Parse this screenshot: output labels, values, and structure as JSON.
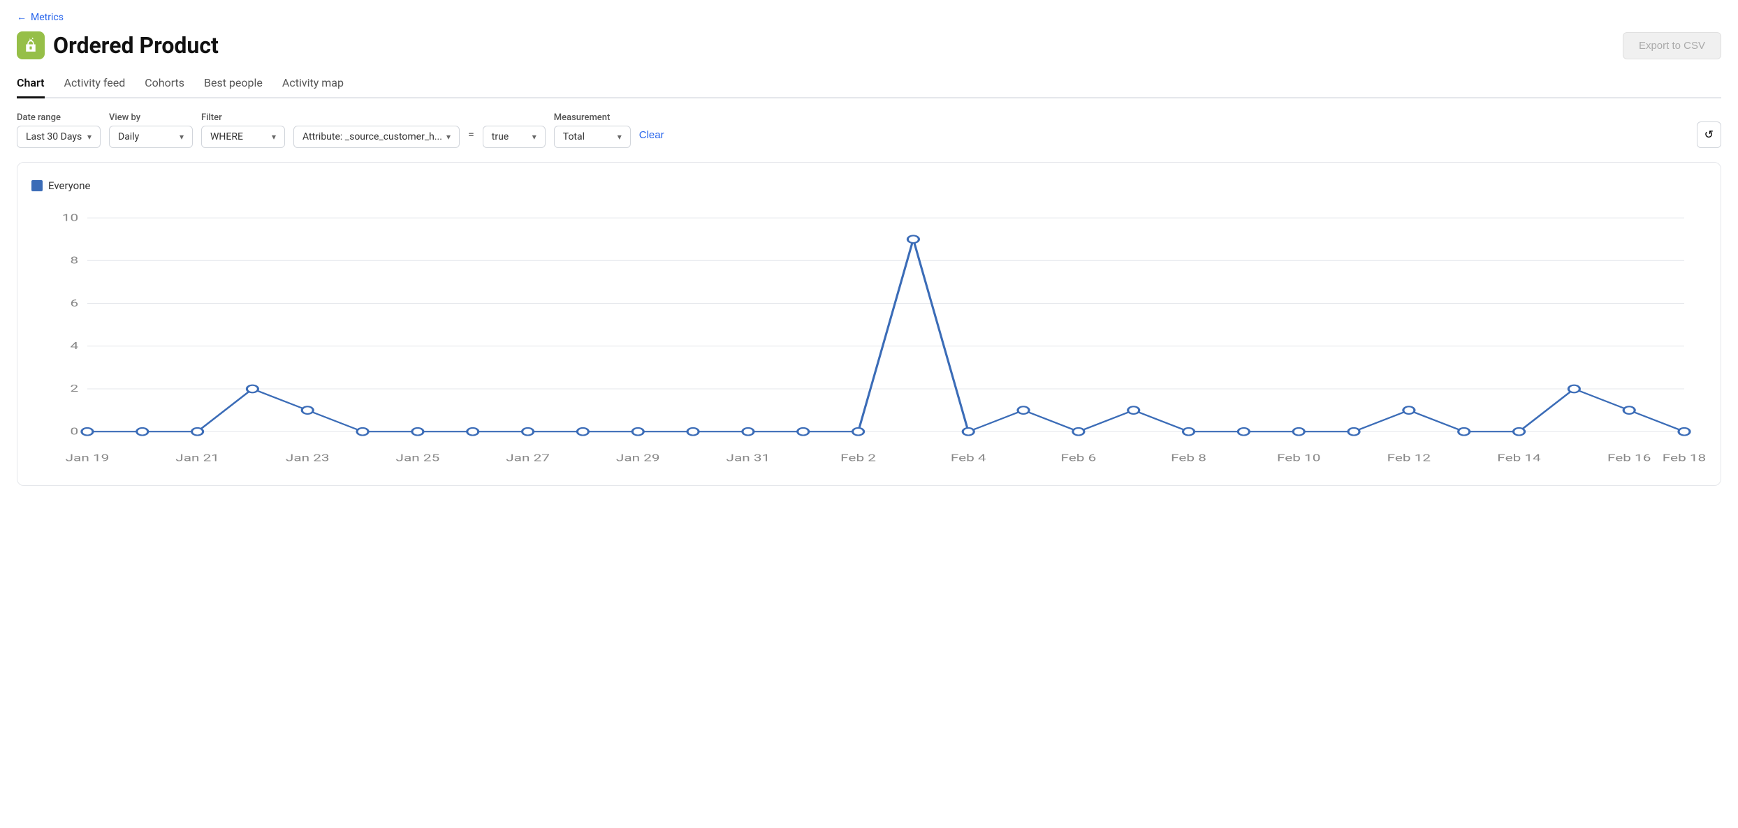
{
  "back": {
    "label": "Metrics",
    "arrow": "←"
  },
  "header": {
    "title": "Ordered Product",
    "export_label": "Export to CSV"
  },
  "tabs": [
    {
      "id": "chart",
      "label": "Chart",
      "active": true
    },
    {
      "id": "activity-feed",
      "label": "Activity feed",
      "active": false
    },
    {
      "id": "cohorts",
      "label": "Cohorts",
      "active": false
    },
    {
      "id": "best-people",
      "label": "Best people",
      "active": false
    },
    {
      "id": "activity-map",
      "label": "Activity map",
      "active": false
    }
  ],
  "filters": {
    "date_range": {
      "label": "Date range",
      "value": "Last 30 Days"
    },
    "view_by": {
      "label": "View by",
      "value": "Daily"
    },
    "filter_type": {
      "label": "Filter",
      "value": "WHERE"
    },
    "attribute": {
      "value": "Attribute: _source_customer_h..."
    },
    "equals": "=",
    "filter_value": {
      "value": "true"
    },
    "measurement": {
      "label": "Measurement",
      "value": "Total"
    },
    "clear_label": "Clear"
  },
  "chart": {
    "legend": "Everyone",
    "legend_color": "#3b6cb7",
    "y_labels": [
      "0",
      "2",
      "4",
      "6",
      "8",
      "10"
    ],
    "x_labels": [
      "Jan 19",
      "Jan 21",
      "Jan 23",
      "Jan 25",
      "Jan 27",
      "Jan 29",
      "Jan 31",
      "Feb 2",
      "Feb 4",
      "Feb 6",
      "Feb 8",
      "Feb 10",
      "Feb 12",
      "Feb 14",
      "Feb 16",
      "Feb 18"
    ],
    "data_points": [
      {
        "x": 0,
        "y": 0
      },
      {
        "x": 1,
        "y": 0
      },
      {
        "x": 2,
        "y": 0
      },
      {
        "x": 3,
        "y": 2
      },
      {
        "x": 4,
        "y": 1
      },
      {
        "x": 5,
        "y": 0
      },
      {
        "x": 6,
        "y": 0
      },
      {
        "x": 7,
        "y": 0
      },
      {
        "x": 8,
        "y": 0
      },
      {
        "x": 9,
        "y": 0
      },
      {
        "x": 10,
        "y": 0
      },
      {
        "x": 11,
        "y": 0
      },
      {
        "x": 12,
        "y": 0
      },
      {
        "x": 13,
        "y": 0
      },
      {
        "x": 14,
        "y": 0
      },
      {
        "x": 15,
        "y": 9
      },
      {
        "x": 16,
        "y": 0
      },
      {
        "x": 17,
        "y": 1
      },
      {
        "x": 18,
        "y": 0
      },
      {
        "x": 19,
        "y": 1
      },
      {
        "x": 20,
        "y": 0
      },
      {
        "x": 21,
        "y": 0
      },
      {
        "x": 22,
        "y": 0
      },
      {
        "x": 23,
        "y": 0
      },
      {
        "x": 24,
        "y": 1
      },
      {
        "x": 25,
        "y": 0
      },
      {
        "x": 26,
        "y": 0
      },
      {
        "x": 27,
        "y": 2
      },
      {
        "x": 28,
        "y": 1
      },
      {
        "x": 29,
        "y": 0
      }
    ]
  }
}
